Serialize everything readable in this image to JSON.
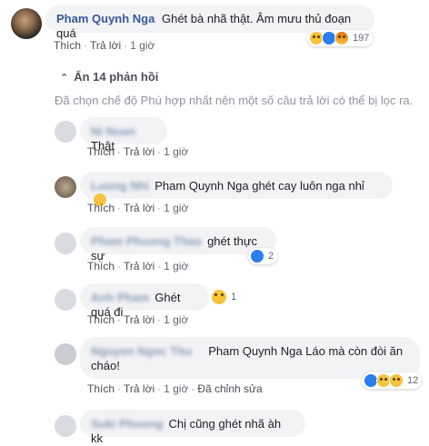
{
  "main_comment": {
    "author": "Pham Quynh Nga",
    "text": "Ghét bà nhã thật. Âm mưu thủ đoạn quá",
    "actions": {
      "like": "Thích",
      "reply": "Trả lời",
      "time": "1 giờ"
    },
    "reactions": {
      "icons": [
        "haha-icon",
        "like-icon",
        "angry-icon"
      ],
      "count": "197"
    }
  },
  "replies_toggle": {
    "label": "Ẩn 14 phản hồi"
  },
  "filter_note": "Đã chọn chế độ Phù hợp nhất nên một số câu trả lời có thể bị lọc ra.",
  "replies": [
    {
      "author": "Ni Nuan",
      "text": "Thật",
      "actions": {
        "like": "Thích",
        "reply": "Trả lời",
        "time": "1 giờ"
      }
    },
    {
      "author": "Luong Nhi",
      "text": "Pham Quynh Nga ghét cay luôn nga nhỉ",
      "emoji": "smile-emoji",
      "actions": {
        "like": "Thích",
        "reply": "Trả lời",
        "time": "1 giờ"
      }
    },
    {
      "author": "Pham Phuong Thao",
      "text": "ghét thực sự",
      "reactions": {
        "icons": [
          "like-icon"
        ],
        "count": "2"
      },
      "actions": {
        "like": "Thích",
        "reply": "Trả lời",
        "time": "1 giờ"
      }
    },
    {
      "author": "Anh Pham",
      "text": "Ghét quá đi",
      "reactions": {
        "icons": [
          "wow-icon"
        ],
        "count": "1"
      },
      "actions": {
        "like": "Thích",
        "reply": "Trả lời",
        "time": "1 giờ"
      }
    },
    {
      "author": "Nguyen Ngoc Thu",
      "text_line1": "Pham Quynh Nga Láo mà còn đòi ăn",
      "text_line2": "cháo!",
      "reactions": {
        "icons": [
          "like-icon",
          "haha-icon",
          "sad-icon"
        ],
        "count": "12"
      },
      "actions": {
        "like": "Thích",
        "reply": "Trả lời",
        "time": "1 giờ",
        "edited": "Đã chỉnh sửa"
      }
    },
    {
      "author": "Suki Phuong",
      "text": "Chị cũng ghét nhã àh kk"
    }
  ],
  "colors": {
    "link": "#385898",
    "bubble": "#f2f3f5",
    "meta": "#606770",
    "like_blue": "#2a7ef0"
  }
}
